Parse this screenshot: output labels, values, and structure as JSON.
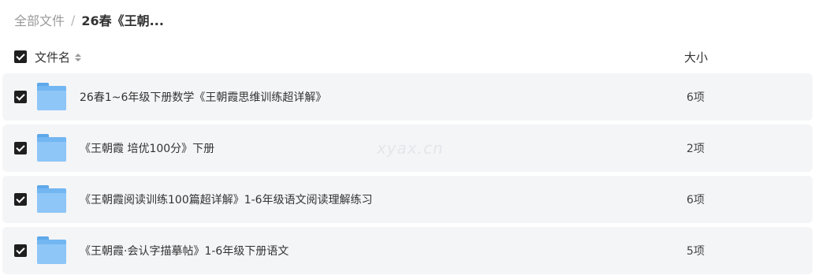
{
  "breadcrumb": {
    "root": "全部文件",
    "separator": "/",
    "current": "26春《王朝..."
  },
  "header": {
    "name_label": "文件名",
    "size_label": "大小",
    "select_all_checked": true
  },
  "files": [
    {
      "name": "26春1~6年级下册数学《王朝霞思维训练超详解》",
      "size": "6项",
      "checked": true
    },
    {
      "name": "《王朝霞 培优100分》下册",
      "size": "2项",
      "checked": true
    },
    {
      "name": "《王朝霞阅读训练100篇超详解》1-6年级语文阅读理解练习",
      "size": "6项",
      "checked": true
    },
    {
      "name": "《王朝霞·会认字描摹帖》1-6年级下册语文",
      "size": "5项",
      "checked": true
    }
  ],
  "watermark": "xyax.cn",
  "colors": {
    "row_bg": "#f4f5f7",
    "folder": "#72b6f2",
    "checkbox": "#1f1f1f"
  }
}
